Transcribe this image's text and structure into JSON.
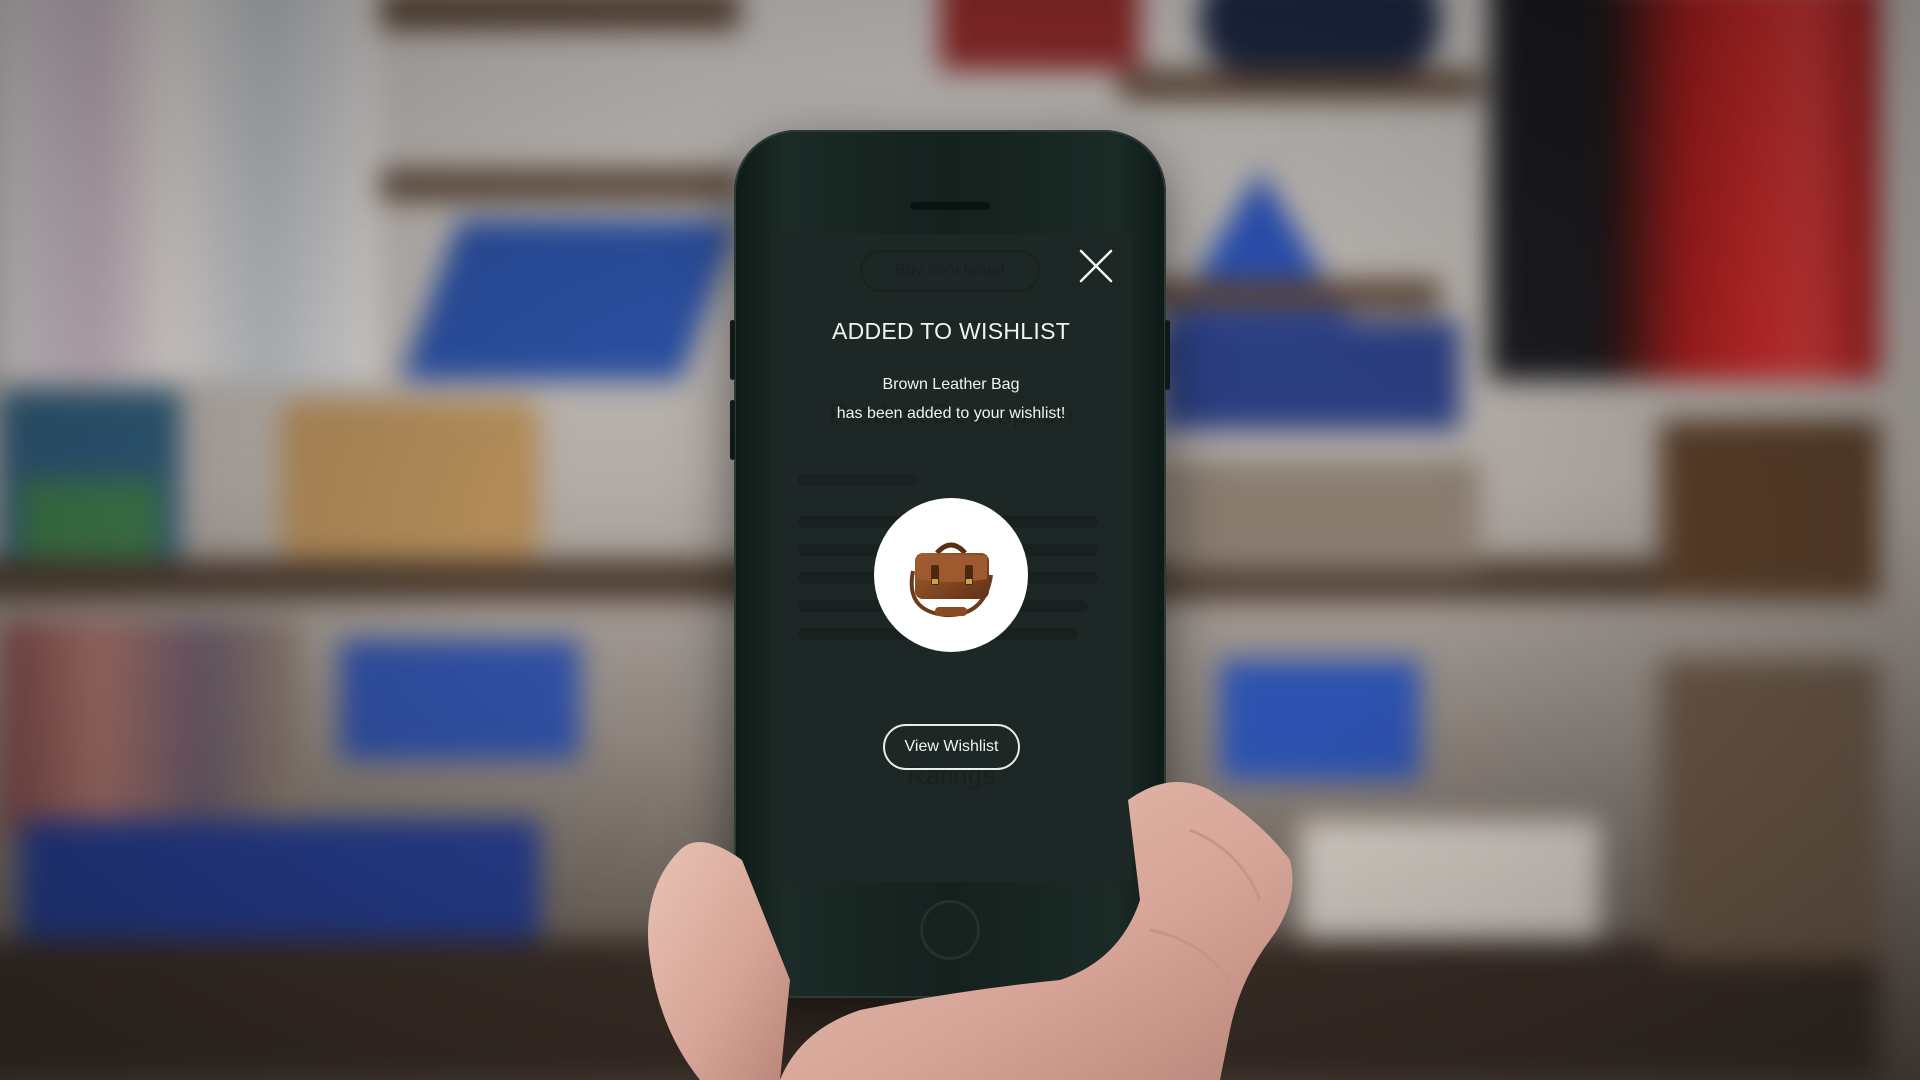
{
  "background_page": {
    "buy_button_label": "Buy from brand",
    "section_title": "Product Description",
    "ratings_heading": "Ratings"
  },
  "modal": {
    "title": "ADDED TO WISHLIST",
    "product_name": "Brown Leather Bag",
    "message": "has been added to your wishlist!",
    "view_button_label": "View Wishlist",
    "close_icon": "close-icon",
    "product_image": "brown-leather-bag-image"
  },
  "colors": {
    "screen_background": "#1d2725",
    "text": "#f2f2ee",
    "phone_body": "#14211e"
  }
}
